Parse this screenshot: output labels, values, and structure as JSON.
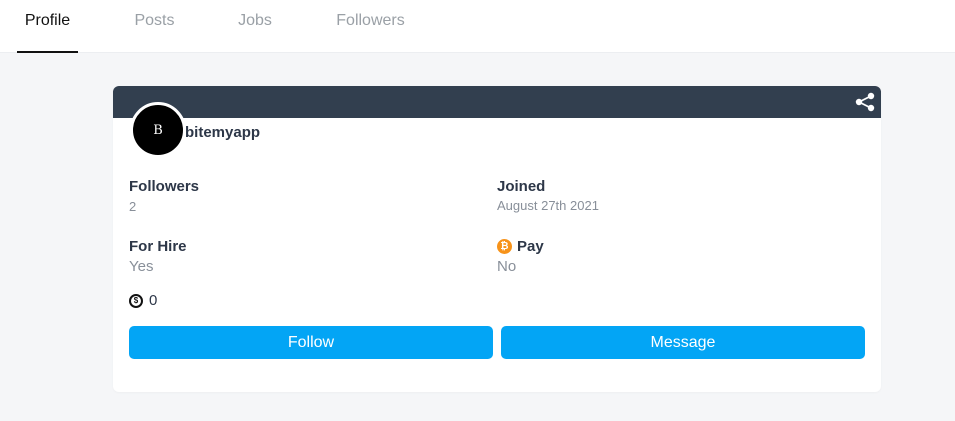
{
  "tabs": [
    {
      "label": "Profile",
      "active": true
    },
    {
      "label": "Posts",
      "active": false
    },
    {
      "label": "Jobs",
      "active": false
    },
    {
      "label": "Followers",
      "active": false
    }
  ],
  "profile": {
    "avatar_initial": "B",
    "username": "bitemyapp",
    "followers_label": "Followers",
    "followers_value": "2",
    "joined_label": "Joined",
    "joined_value": "August 27th 2021",
    "for_hire_label": "For Hire",
    "for_hire_value": "Yes",
    "pay_label": "Pay",
    "pay_value": "No",
    "credits_value": "0",
    "pay_icon": "bitcoin-icon",
    "credits_icon": "credit-coin-icon"
  },
  "actions": {
    "follow_label": "Follow",
    "message_label": "Message"
  },
  "colors": {
    "banner": "#323f4f",
    "button": "#03a5f5",
    "background": "#f5f6f8",
    "bitcoin": "#f7931a"
  }
}
